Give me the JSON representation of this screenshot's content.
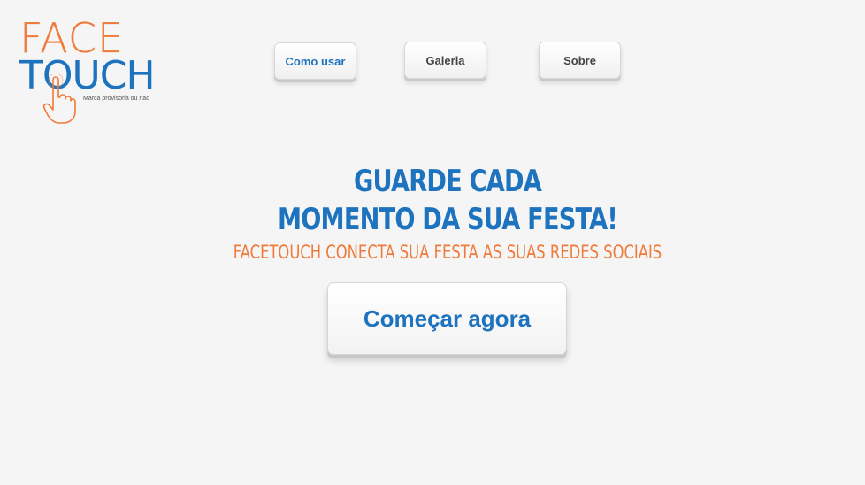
{
  "logo": {
    "line1": "FACE",
    "line2": "TOUCH",
    "tagline": "Marca provisoria ou nao"
  },
  "nav": {
    "items": [
      {
        "label": "Como usar"
      },
      {
        "label": "Galeria"
      },
      {
        "label": "Sobre"
      }
    ]
  },
  "hero": {
    "headline_line1": "GUARDE CADA",
    "headline_line2": "MOMENTO DA SUA FESTA!",
    "subheadline": "FACETOUCH CONECTA SUA FESTA AS SUAS REDES SOCIAIS",
    "cta_label": "Começar agora"
  },
  "colors": {
    "brand_blue": "#1e73be",
    "brand_orange": "#f07a3a",
    "background": "#f5f5f5"
  }
}
